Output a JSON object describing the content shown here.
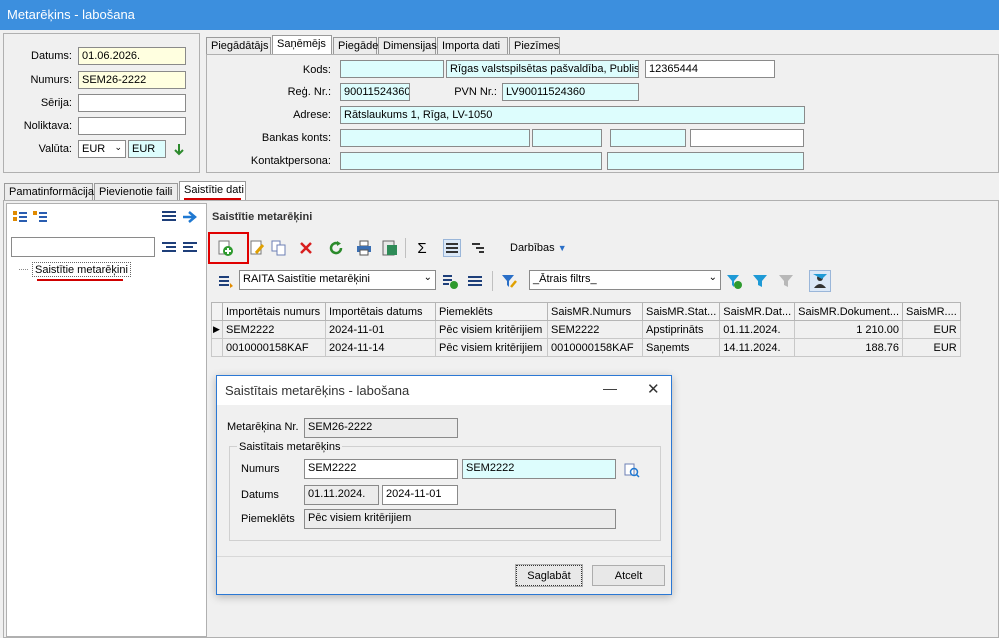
{
  "window": {
    "title": "Metarēķins - labošana"
  },
  "header": {
    "datums_label": "Datums:",
    "datums": "01.06.2026.",
    "numurs_label": "Numurs:",
    "numurs": "SEM26-2222",
    "serija_label": "Sērija:",
    "serija": "",
    "noliktava_label": "Noliktava:",
    "noliktava": "",
    "valuta_label": "Valūta:",
    "valuta": "EUR",
    "valuta2": "EUR"
  },
  "party_tabs": [
    "Piegādātājs",
    "Saņēmējs",
    "Piegāde",
    "Dimensijas",
    "Importa dati",
    "Piezīmes"
  ],
  "party": {
    "kods_label": "Kods:",
    "kods": "",
    "kods_name": "Rīgas valstspilsētas pašvaldība, Publiskā",
    "kods_extra": "12365444",
    "reg_label": "Reģ. Nr.:",
    "reg": "90011524360",
    "pvn_label": "PVN Nr.:",
    "pvn": "LV90011524360",
    "adrese_label": "Adrese:",
    "adrese": "Rātslaukums 1, Rīga, LV-1050",
    "bank_label": "Bankas konts:",
    "kontakt_label": "Kontaktpersona:"
  },
  "main_tabs": [
    "Pamatinformācija",
    "Pievienotie faili",
    "Saistītie dati"
  ],
  "tree": {
    "item": "Saistītie metarēķini"
  },
  "section_title": "Saistītie metarēķini",
  "toolbar": {
    "actions_label": "Darbības"
  },
  "view_select": "RAITA Saistītie metarēķini",
  "filter_select": "_Ātrais filtrs_",
  "grid": {
    "columns": [
      "Importētais numurs",
      "Importētais datums",
      "Piemeklēts",
      "SaisMR.Numurs",
      "SaisMR.Stat...",
      "SaisMR.Dat...",
      "SaisMR.Dokument...",
      "SaisMR...."
    ],
    "rows": [
      [
        "SEM2222",
        "2024-11-01",
        "Pēc visiem kritērijiem",
        "SEM2222",
        "Apstiprināts",
        "01.11.2024.",
        "1 210.00",
        "EUR"
      ],
      [
        "0010000158KAF",
        "2024-11-14",
        "Pēc visiem kritērijiem",
        "0010000158KAF",
        "Saņemts",
        "14.11.2024.",
        "188.76",
        "EUR"
      ]
    ]
  },
  "dialog": {
    "title": "Saistītais metarēķins - labošana",
    "mr_label": "Metarēķina Nr.",
    "mr_value": "SEM26-2222",
    "group_label": "Saistītais metarēķins",
    "numurs_label": "Numurs",
    "numurs1": "SEM2222",
    "numurs2": "SEM2222",
    "datums_label": "Datums",
    "datums1": "01.11.2024.",
    "datums2": "2024-11-01",
    "piem_label": "Piemeklēts",
    "piem_value": "Pēc visiem kritērijiem",
    "save": "Saglabāt",
    "cancel": "Atcelt"
  }
}
